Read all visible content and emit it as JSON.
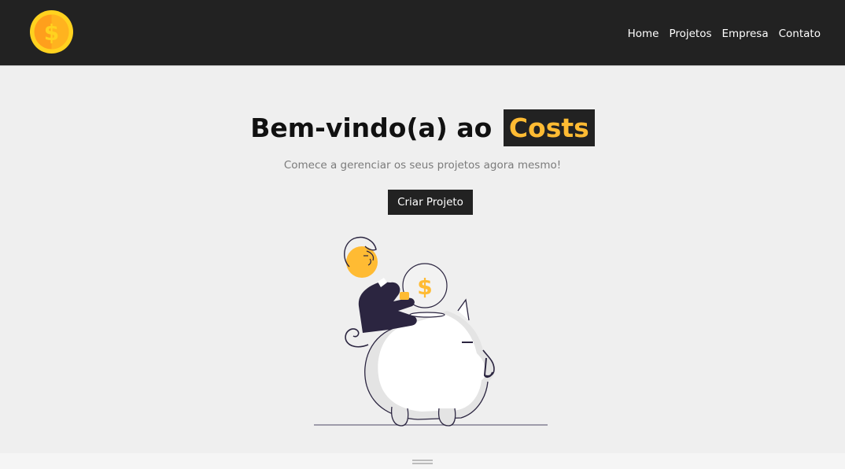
{
  "navbar": {
    "logo_icon": "coin-dollar-icon",
    "links": [
      "Home",
      "Projetos",
      "Empresa",
      "Contato"
    ]
  },
  "hero": {
    "title": "Bem-vindo(a) ao",
    "brand": "Costs",
    "subtitle": "Comece a gerenciar os seus projetos agora mesmo!",
    "cta_label": "Criar Projeto",
    "illustration_icon": "piggy-bank-savings-illustration"
  },
  "footer": {
    "grip_icon": "drag-handle-icon"
  },
  "colors": {
    "navbar_bg": "#222222",
    "page_bg": "#efefef",
    "accent": "#ffbb33",
    "text_muted": "#7b7b7b",
    "illustration_purple": "#2b2540"
  }
}
